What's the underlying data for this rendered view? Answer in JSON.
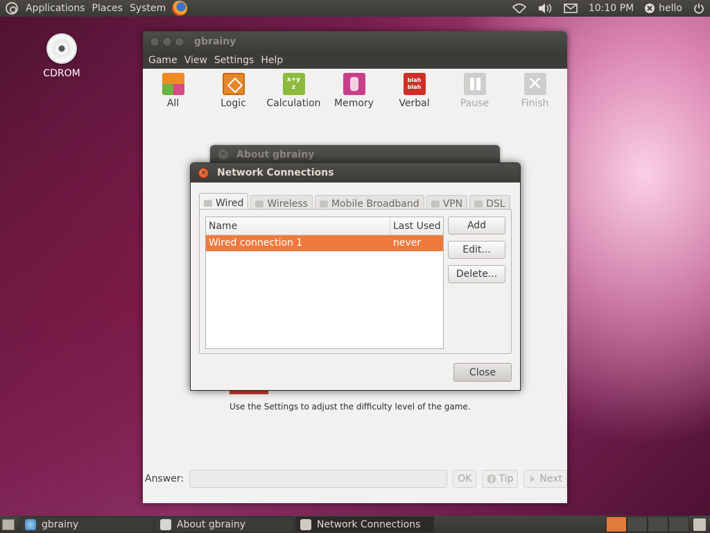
{
  "top_panel": {
    "menus": [
      "Applications",
      "Places",
      "System"
    ],
    "clock": "10:10 PM",
    "user": "hello"
  },
  "desktop": {
    "icons": [
      {
        "label": "CDROM",
        "icon": "disc-icon"
      }
    ]
  },
  "gbrainy": {
    "title": "gbrainy",
    "menu": [
      "Game",
      "View",
      "Settings",
      "Help"
    ],
    "toolbar": [
      {
        "label": "All",
        "icon": "all-games-icon",
        "enabled": true
      },
      {
        "label": "Logic",
        "icon": "logic-icon",
        "enabled": true
      },
      {
        "label": "Calculation",
        "icon": "calculation-icon",
        "enabled": true
      },
      {
        "label": "Memory",
        "icon": "memory-icon",
        "enabled": true
      },
      {
        "label": "Verbal",
        "icon": "verbal-icon",
        "enabled": true
      },
      {
        "label": "Pause",
        "icon": "pause-icon",
        "enabled": false
      },
      {
        "label": "Finish",
        "icon": "finish-icon",
        "enabled": false
      }
    ],
    "description": "Use the Settings to adjust the difficulty level of the game.",
    "answer_label": "Answer:",
    "answer_value": "",
    "buttons": {
      "ok": "OK",
      "tip": "Tip",
      "next": "Next"
    },
    "calc_icon_text": "x+y\nz",
    "verbal_icon_text": "blah\nblah",
    "finish_icon_text": "✕"
  },
  "about_dialog": {
    "title": "About gbrainy"
  },
  "network_dialog": {
    "title": "Network Connections",
    "tabs": [
      "Wired",
      "Wireless",
      "Mobile Broadband",
      "VPN",
      "DSL"
    ],
    "active_tab": "Wired",
    "columns": [
      "Name",
      "Last Used"
    ],
    "rows": [
      {
        "name": "Wired connection 1",
        "last_used": "never",
        "selected": true
      }
    ],
    "side_buttons": [
      "Add",
      "Edit...",
      "Delete..."
    ],
    "close_button": "Close"
  },
  "taskbar": {
    "tasks": [
      {
        "label": "gbrainy",
        "icon": "gbrainy-icon"
      },
      {
        "label": "About gbrainy",
        "icon": "about-icon"
      },
      {
        "label": "Network Connections",
        "icon": "network-icon"
      }
    ]
  },
  "colors": {
    "selection": "#ef7a3d",
    "panel": "#3c3b37",
    "close_button": "#d9461a"
  }
}
